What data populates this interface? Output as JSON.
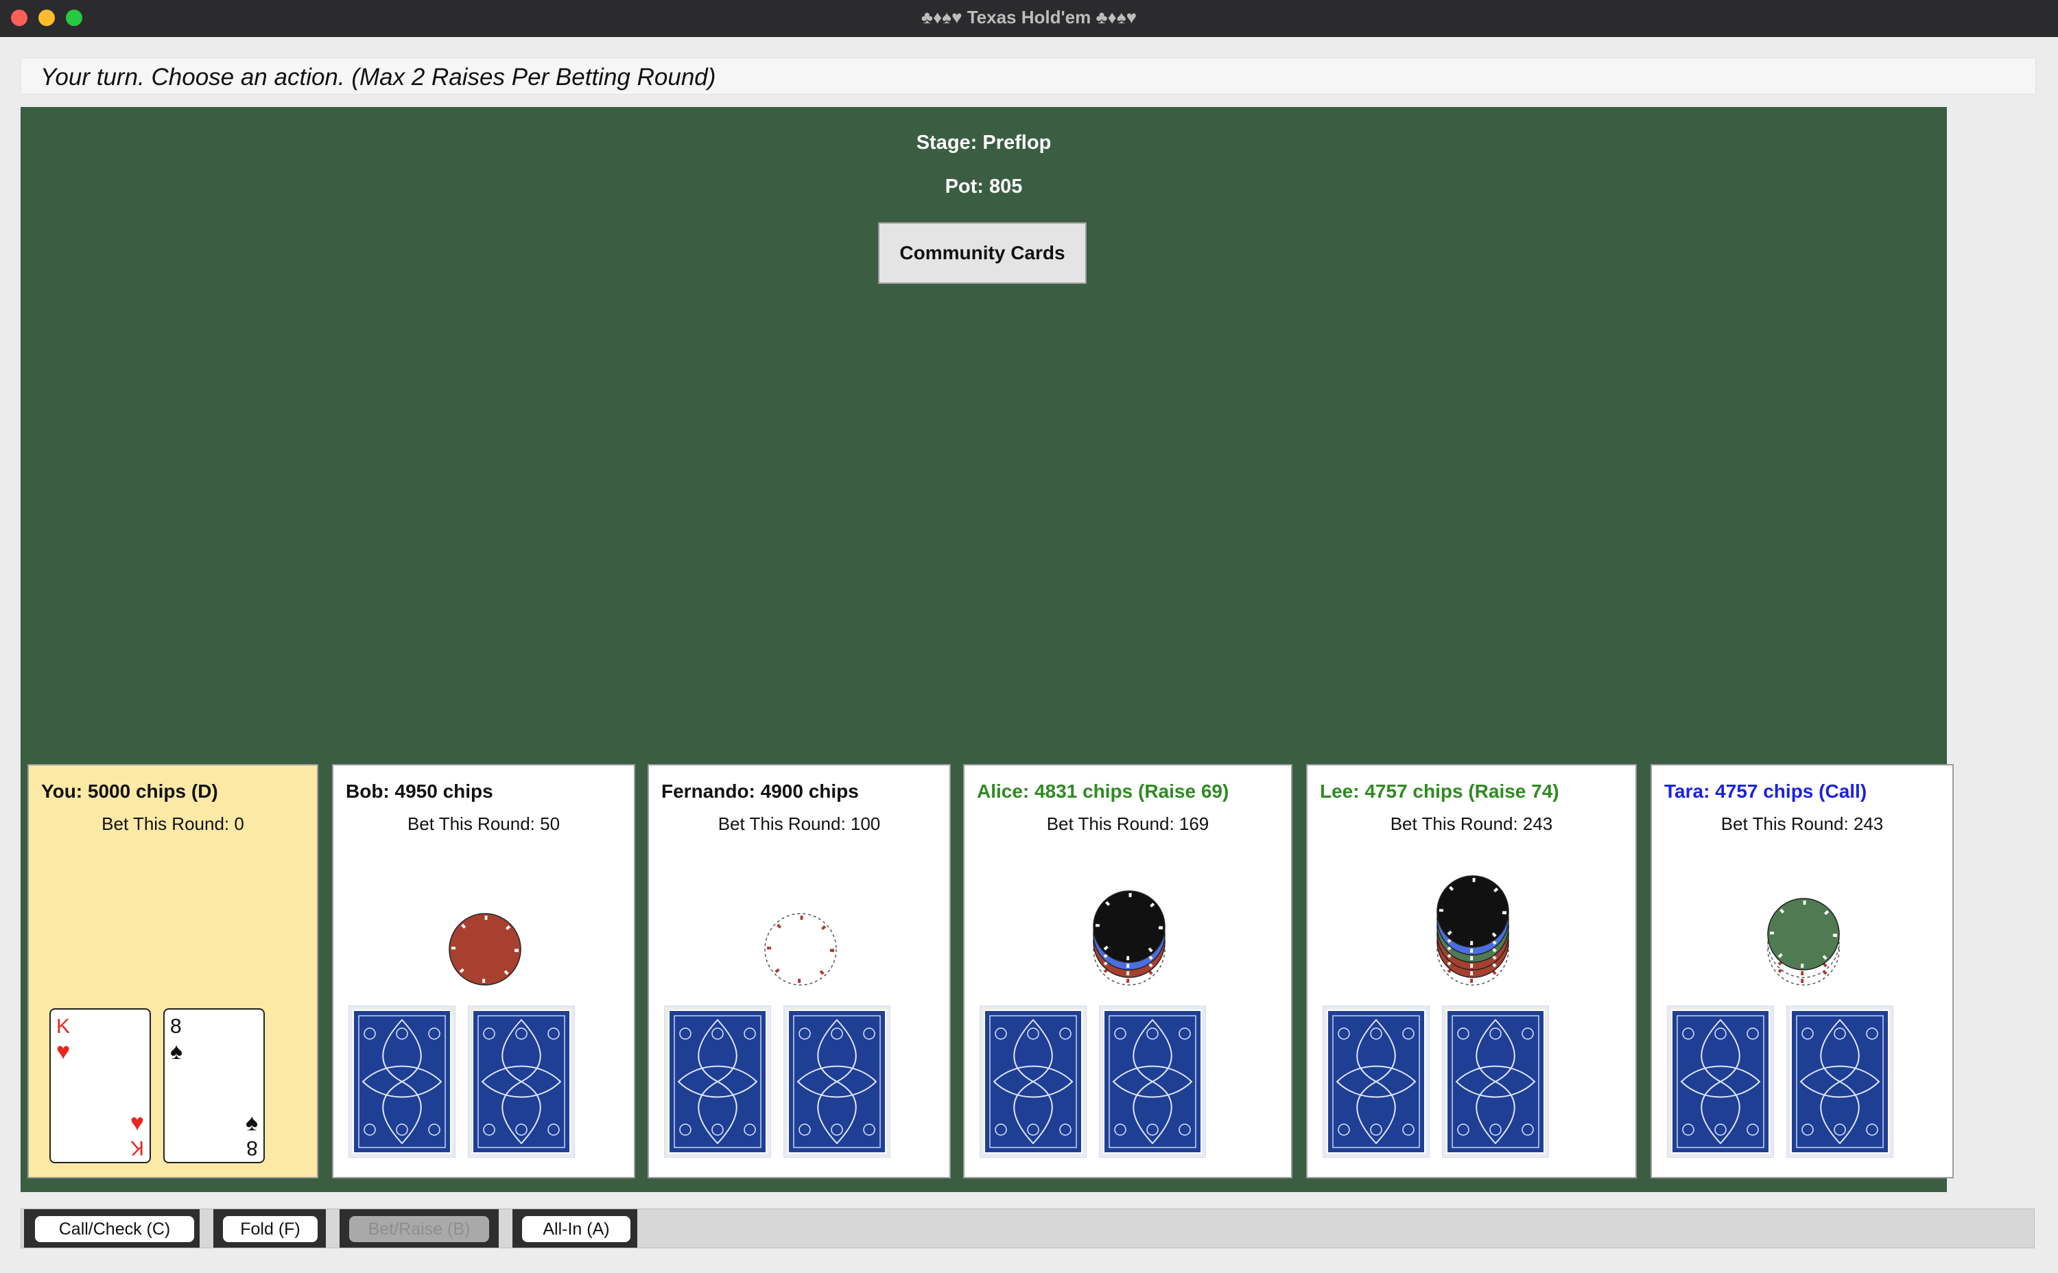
{
  "window": {
    "title": "♣♦♠♥ Texas Hold'em ♣♦♠♥"
  },
  "status_message": "Your turn. Choose an action. (Max 2 Raises Per Betting Round)",
  "table": {
    "stage": "Stage: Preflop",
    "pot": "Pot: 805",
    "community_button": "Community Cards",
    "felt_color": "#3b5d42"
  },
  "players": [
    {
      "name": "You: 5000 chips (D)",
      "bet": "Bet This Round: 0",
      "name_color": "#111111",
      "highlight": true,
      "cards": [
        {
          "rank": "K",
          "suit": "♥",
          "color": "#e8251f"
        },
        {
          "rank": "8",
          "suit": "♠",
          "color": "#111111"
        }
      ],
      "chips": []
    },
    {
      "name": "Bob: 4950 chips",
      "bet": "Bet This Round: 50",
      "name_color": "#111111",
      "cards_hidden": true,
      "chips": [
        "red"
      ]
    },
    {
      "name": "Fernando: 4900 chips",
      "bet": "Bet This Round: 100",
      "name_color": "#111111",
      "cards_hidden": true,
      "chips": [
        "white"
      ]
    },
    {
      "name": "Alice: 4831 chips (Raise 69)",
      "bet": "Bet This Round: 169",
      "name_color": "#2f8a22",
      "cards_hidden": true,
      "chips": [
        "white",
        "red",
        "blue",
        "black"
      ]
    },
    {
      "name": "Lee: 4757 chips (Raise 74)",
      "bet": "Bet This Round: 243",
      "name_color": "#2f8a22",
      "cards_hidden": true,
      "chips": [
        "white",
        "red",
        "red",
        "green",
        "blue",
        "black"
      ]
    },
    {
      "name": "Tara: 4757 chips (Call)",
      "bet": "Bet This Round: 243",
      "name_color": "#1a22e0",
      "cards_hidden": true,
      "chips": [
        "white",
        "white",
        "green"
      ]
    }
  ],
  "actions": {
    "call": "Call/Check (C)",
    "fold": "Fold (F)",
    "raise": "Bet/Raise (B)",
    "allin": "All-In (A)"
  }
}
